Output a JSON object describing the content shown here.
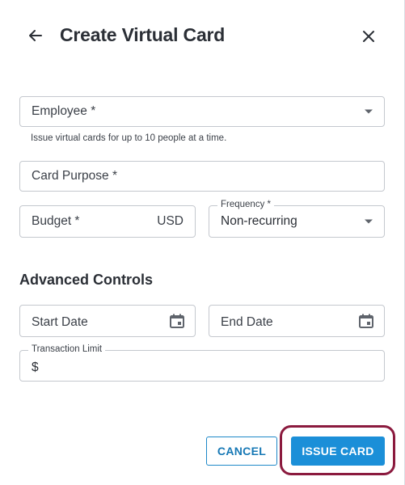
{
  "header": {
    "title": "Create Virtual Card",
    "back_icon": "arrow-left-icon",
    "close_icon": "close-icon"
  },
  "form": {
    "employee": {
      "label": "Employee *",
      "helper": "Issue virtual cards for up to 10 people at a time."
    },
    "card_purpose": {
      "label": "Card Purpose *"
    },
    "budget": {
      "label": "Budget *",
      "currency": "USD"
    },
    "frequency": {
      "label": "Frequency *",
      "value": "Non-recurring"
    }
  },
  "advanced": {
    "title": "Advanced Controls",
    "start_date": {
      "label": "Start Date"
    },
    "end_date": {
      "label": "End Date"
    },
    "transaction_limit": {
      "label": "Transaction Limit",
      "prefix": "$"
    }
  },
  "actions": {
    "cancel_label": "CANCEL",
    "issue_label": "ISSUE CARD"
  },
  "colors": {
    "primary": "#1b8fd8",
    "highlight_ring": "#8b1a3e"
  }
}
